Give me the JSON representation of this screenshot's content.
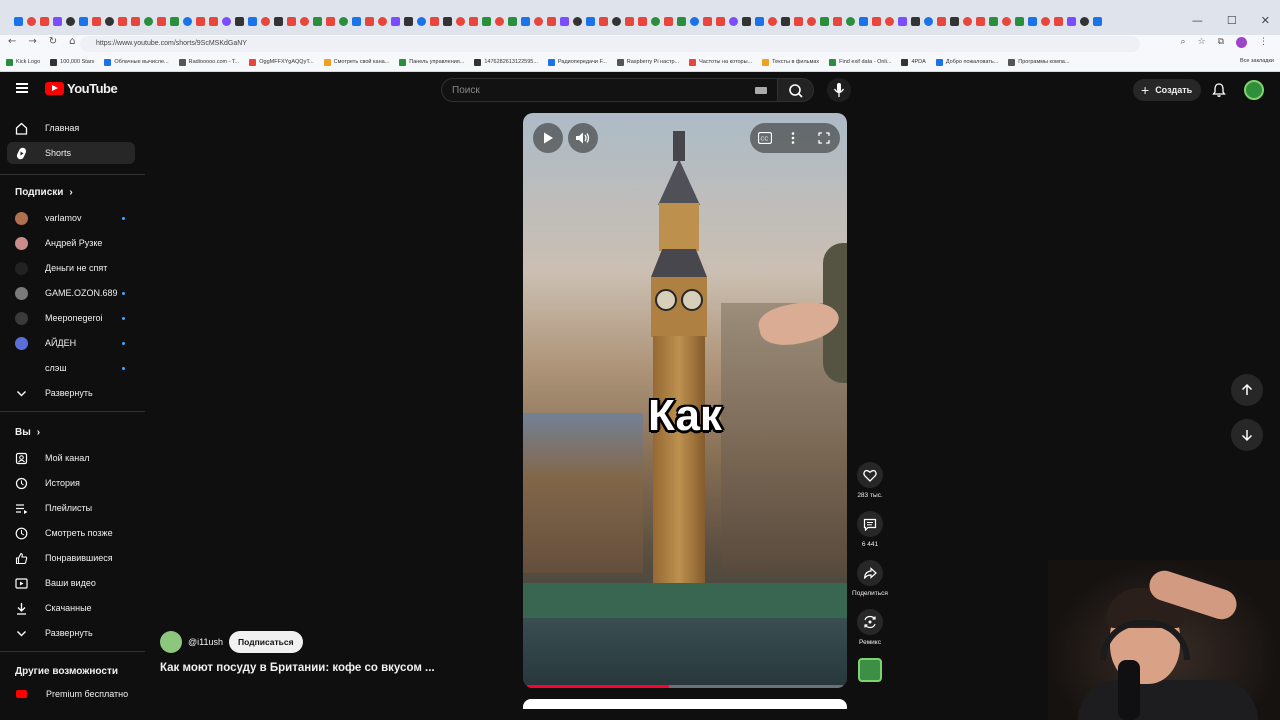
{
  "browser": {
    "url": "https://www.youtube.com/shorts/9ScMSKdGaNY",
    "bookmarks": [
      "Kick Logo",
      "100,000 Stars",
      "Облачные вычисле...",
      "Radiooooo.com - T...",
      "OggMFFXYgAQQyT...",
      "Смотреть свой кана...",
      "Панель управления...",
      "1476282613122595...",
      "Радиопередачи F...",
      "Raspberry Pi настр...",
      "Частоты на которы...",
      "Тексты в фильмах",
      "Find exif data - Onli...",
      "4PDA",
      "Добро пожаловать...",
      "Программы компа..."
    ],
    "bookmarks_all": "Все закладки",
    "tab_colors": [
      "#1a73e8",
      "#e8453c",
      "#e8453c",
      "#7c4dff",
      "#333333",
      "#1a73e8",
      "#e8453c",
      "#333333",
      "#e8453c",
      "#e8453c",
      "#2a8f3d",
      "#e8453c",
      "#2a8f3d"
    ]
  },
  "header": {
    "logo_text": "YouTube",
    "search_placeholder": "Поиск",
    "create_label": "Создать"
  },
  "sidebar": {
    "main": [
      {
        "label": "Главная",
        "icon": "home-icon"
      },
      {
        "label": "Shorts",
        "icon": "shorts-icon",
        "active": true
      }
    ],
    "subscriptions_title": "Подписки",
    "subscriptions": [
      {
        "label": "varlamov",
        "color": "#b0704f",
        "new": true
      },
      {
        "label": "Андрей Рузке",
        "color": "#c98c8c",
        "new": false
      },
      {
        "label": "Деньги не спят",
        "color": "#222222",
        "new": false
      },
      {
        "label": "GAME.OZON.689",
        "color": "#7a7a7a",
        "new": true
      },
      {
        "label": "Meeponegeroi",
        "color": "#3a3a3a",
        "new": true
      },
      {
        "label": "АЙДЕН",
        "color": "#5b6fd6",
        "new": true
      },
      {
        "label": "слэш",
        "color": "#0f0f0f",
        "new": true
      }
    ],
    "expand_label": "Развернуть",
    "you_title": "Вы",
    "you_items": [
      {
        "label": "Мой канал",
        "icon": "channel-icon"
      },
      {
        "label": "История",
        "icon": "history-icon"
      },
      {
        "label": "Плейлисты",
        "icon": "playlists-icon"
      },
      {
        "label": "Смотреть позже",
        "icon": "watch-later-icon"
      },
      {
        "label": "Понравившиеся",
        "icon": "like-icon"
      },
      {
        "label": "Ваши видео",
        "icon": "your-videos-icon"
      },
      {
        "label": "Скачанные",
        "icon": "download-icon"
      }
    ],
    "expand_label_2": "Развернуть",
    "more_title": "Другие возможности",
    "premium_label": "Premium бесплатно"
  },
  "video": {
    "caption": "Как",
    "progress": 0.45
  },
  "actions": {
    "likes": "283 тыс.",
    "comments": "6 441",
    "share_label": "Поделиться",
    "remix_label": "Ремикс"
  },
  "channel": {
    "handle": "@i11ush",
    "subscribe_label": "Подписаться"
  },
  "short_title": "Как моют посуду в Британии: кофе со вкусом ..."
}
